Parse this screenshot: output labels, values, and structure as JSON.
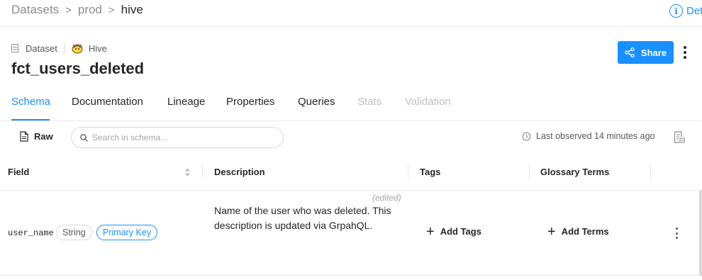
{
  "breadcrumb": {
    "items": [
      "Datasets",
      "prod",
      "hive"
    ],
    "separator": ">"
  },
  "details_link": "Det",
  "entity": {
    "type_label": "Dataset",
    "platform": "Hive",
    "name": "fct_users_deleted"
  },
  "header_actions": {
    "share_label": "Share"
  },
  "tabs": [
    {
      "label": "Schema",
      "state": "active"
    },
    {
      "label": "Documentation",
      "state": "normal"
    },
    {
      "label": "Lineage",
      "state": "normal"
    },
    {
      "label": "Properties",
      "state": "normal"
    },
    {
      "label": "Queries",
      "state": "normal"
    },
    {
      "label": "Stats",
      "state": "disabled"
    },
    {
      "label": "Validation",
      "state": "disabled"
    }
  ],
  "toolbar": {
    "raw_label": "Raw",
    "search_placeholder": "Search in schema...",
    "last_observed": "Last observed 14 minutes ago"
  },
  "table": {
    "columns": [
      "Field",
      "Description",
      "Tags",
      "Glossary Terms"
    ],
    "rows": [
      {
        "field": "user_name",
        "type": "String",
        "badge": "Primary Key",
        "edited_label": "(edited)",
        "description": "Name of the user who was deleted. This description is updated via GrpahQL.",
        "add_tags_label": "Add Tags",
        "add_terms_label": "Add Terms"
      }
    ]
  },
  "colors": {
    "accent": "#1890ff",
    "text": "#262626",
    "muted": "#8c8c8c",
    "disabled": "#bfbfbf",
    "border": "#ececec"
  }
}
